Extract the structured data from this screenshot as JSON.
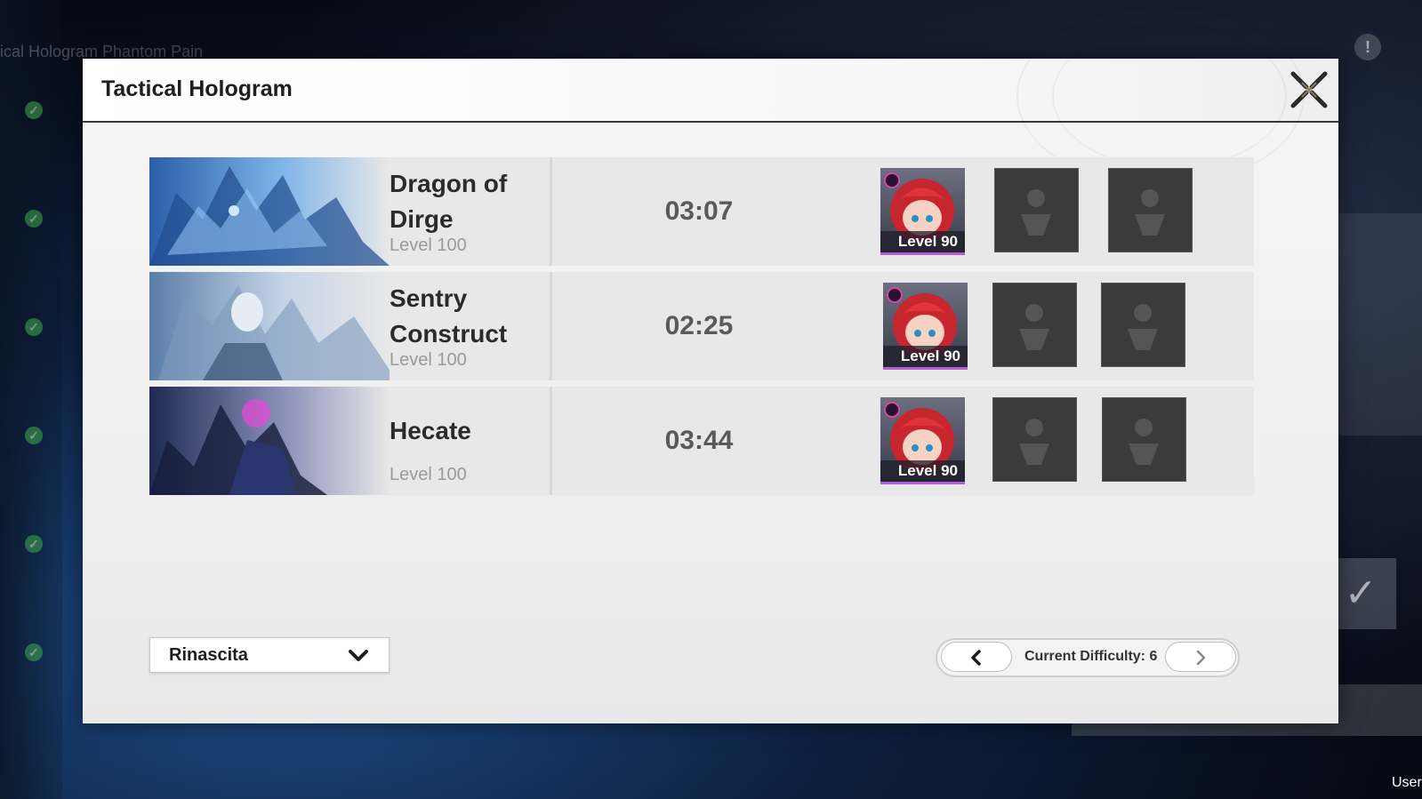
{
  "background": {
    "header_text": "ical Hologram Phantom Pain",
    "user_label": "User"
  },
  "modal": {
    "title": "Tactical Hologram"
  },
  "bosses": [
    {
      "name": "Dragon of Dirge",
      "level": "Level 100",
      "time": "03:07",
      "team": [
        {
          "level": "Level 90"
        },
        {
          "empty": true
        },
        {
          "empty": true
        }
      ]
    },
    {
      "name": "Sentry Construct",
      "level": "Level 100",
      "time": "02:25",
      "team": [
        {
          "level": "Level 90"
        },
        {
          "empty": true
        },
        {
          "empty": true
        }
      ]
    },
    {
      "name": "Hecate",
      "level": "Level 100",
      "time": "03:44",
      "team": [
        {
          "level": "Level 90"
        },
        {
          "empty": true
        },
        {
          "empty": true
        }
      ]
    }
  ],
  "region_select": {
    "value": "Rinascita"
  },
  "difficulty": {
    "label": "Current Difficulty: 6",
    "prev_icon": "chevron-left-icon",
    "next_icon": "chevron-right-icon"
  },
  "colors": {
    "accent_purple": "#b45cd8",
    "empty_slot": "#3b3b3b",
    "row_bg": "#e8e8e8"
  }
}
